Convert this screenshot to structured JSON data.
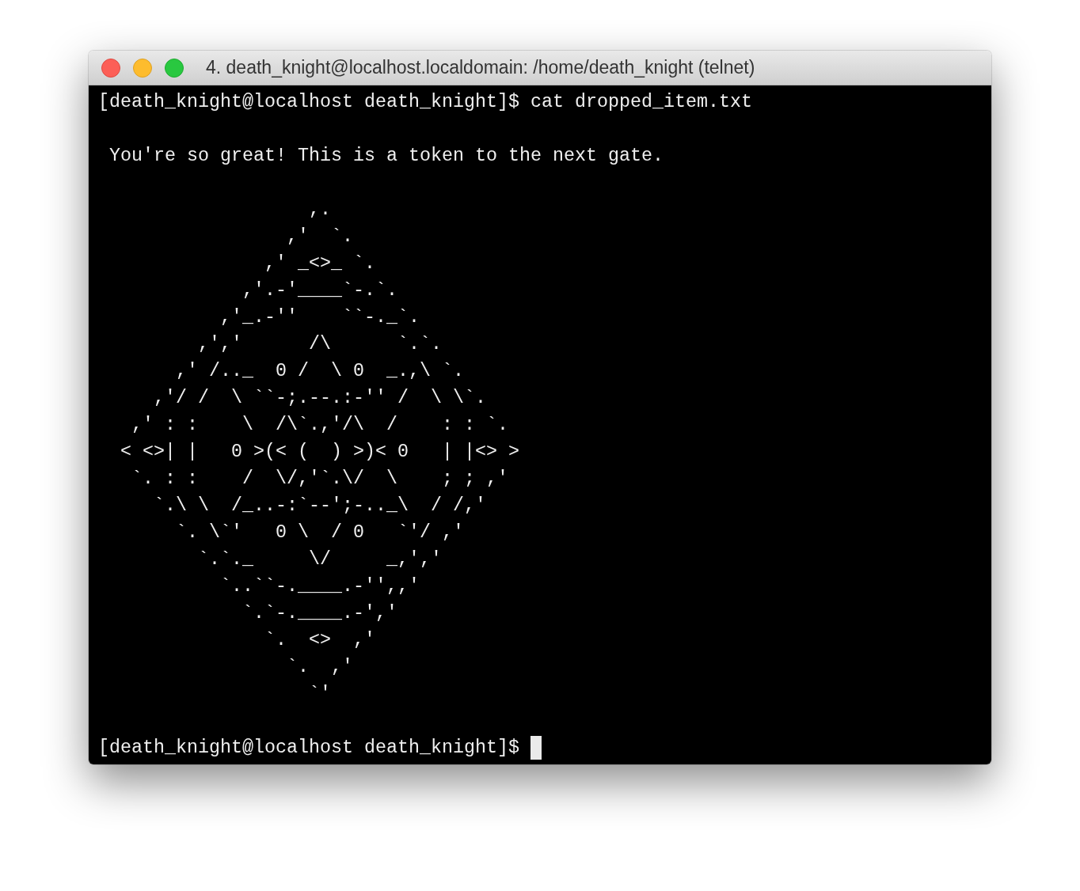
{
  "window": {
    "title": "4. death_knight@localhost.localdomain: /home/death_knight (telnet)"
  },
  "terminal": {
    "lines": [
      {
        "kind": "prompt",
        "prompt": "[death_knight@localhost death_knight]$",
        "command": "cat dropped_item.txt",
        "cursor": false
      },
      {
        "kind": "blank"
      },
      {
        "kind": "output",
        "text": " You're so great! This is a token to the next gate."
      },
      {
        "kind": "blank"
      },
      {
        "kind": "output",
        "text": "                   ,."
      },
      {
        "kind": "output",
        "text": "                 ,'  `."
      },
      {
        "kind": "output",
        "text": "               ,' _<>_ `."
      },
      {
        "kind": "output",
        "text": "             ,'.-'____`-.`."
      },
      {
        "kind": "output",
        "text": "           ,'_.-''    ``-._`."
      },
      {
        "kind": "output",
        "text": "         ,','      /\\      `.`."
      },
      {
        "kind": "output",
        "text": "       ,' /.._  0 /  \\ 0  _.,\\ `."
      },
      {
        "kind": "output",
        "text": "     ,'/ /  \\ ``-;.--.:-'' /  \\ \\`."
      },
      {
        "kind": "output",
        "text": "   ,' : :    \\  /\\`.,'/\\  /    : : `."
      },
      {
        "kind": "output",
        "text": "  < <>| |   0 >(< (  ) >)< 0   | |<> >"
      },
      {
        "kind": "output",
        "text": "   `. : :    /  \\/,'`.\\/  \\    ; ; ,'"
      },
      {
        "kind": "output",
        "text": "     `.\\ \\  /_..-:`--';-.._\\  / /,'"
      },
      {
        "kind": "output",
        "text": "       `. \\`'   0 \\  / 0   `'/ ,'"
      },
      {
        "kind": "output",
        "text": "         `.`._     \\/     _,','"
      },
      {
        "kind": "output",
        "text": "           `..``-.____.-'',,'"
      },
      {
        "kind": "output",
        "text": "             `.`-.____.-','"
      },
      {
        "kind": "output",
        "text": "               `.  <>  ,'"
      },
      {
        "kind": "output",
        "text": "                 `.  ,'"
      },
      {
        "kind": "output",
        "text": "                   `'"
      },
      {
        "kind": "blank"
      },
      {
        "kind": "prompt",
        "prompt": "[death_knight@localhost death_knight]$",
        "cursor": true
      }
    ]
  }
}
